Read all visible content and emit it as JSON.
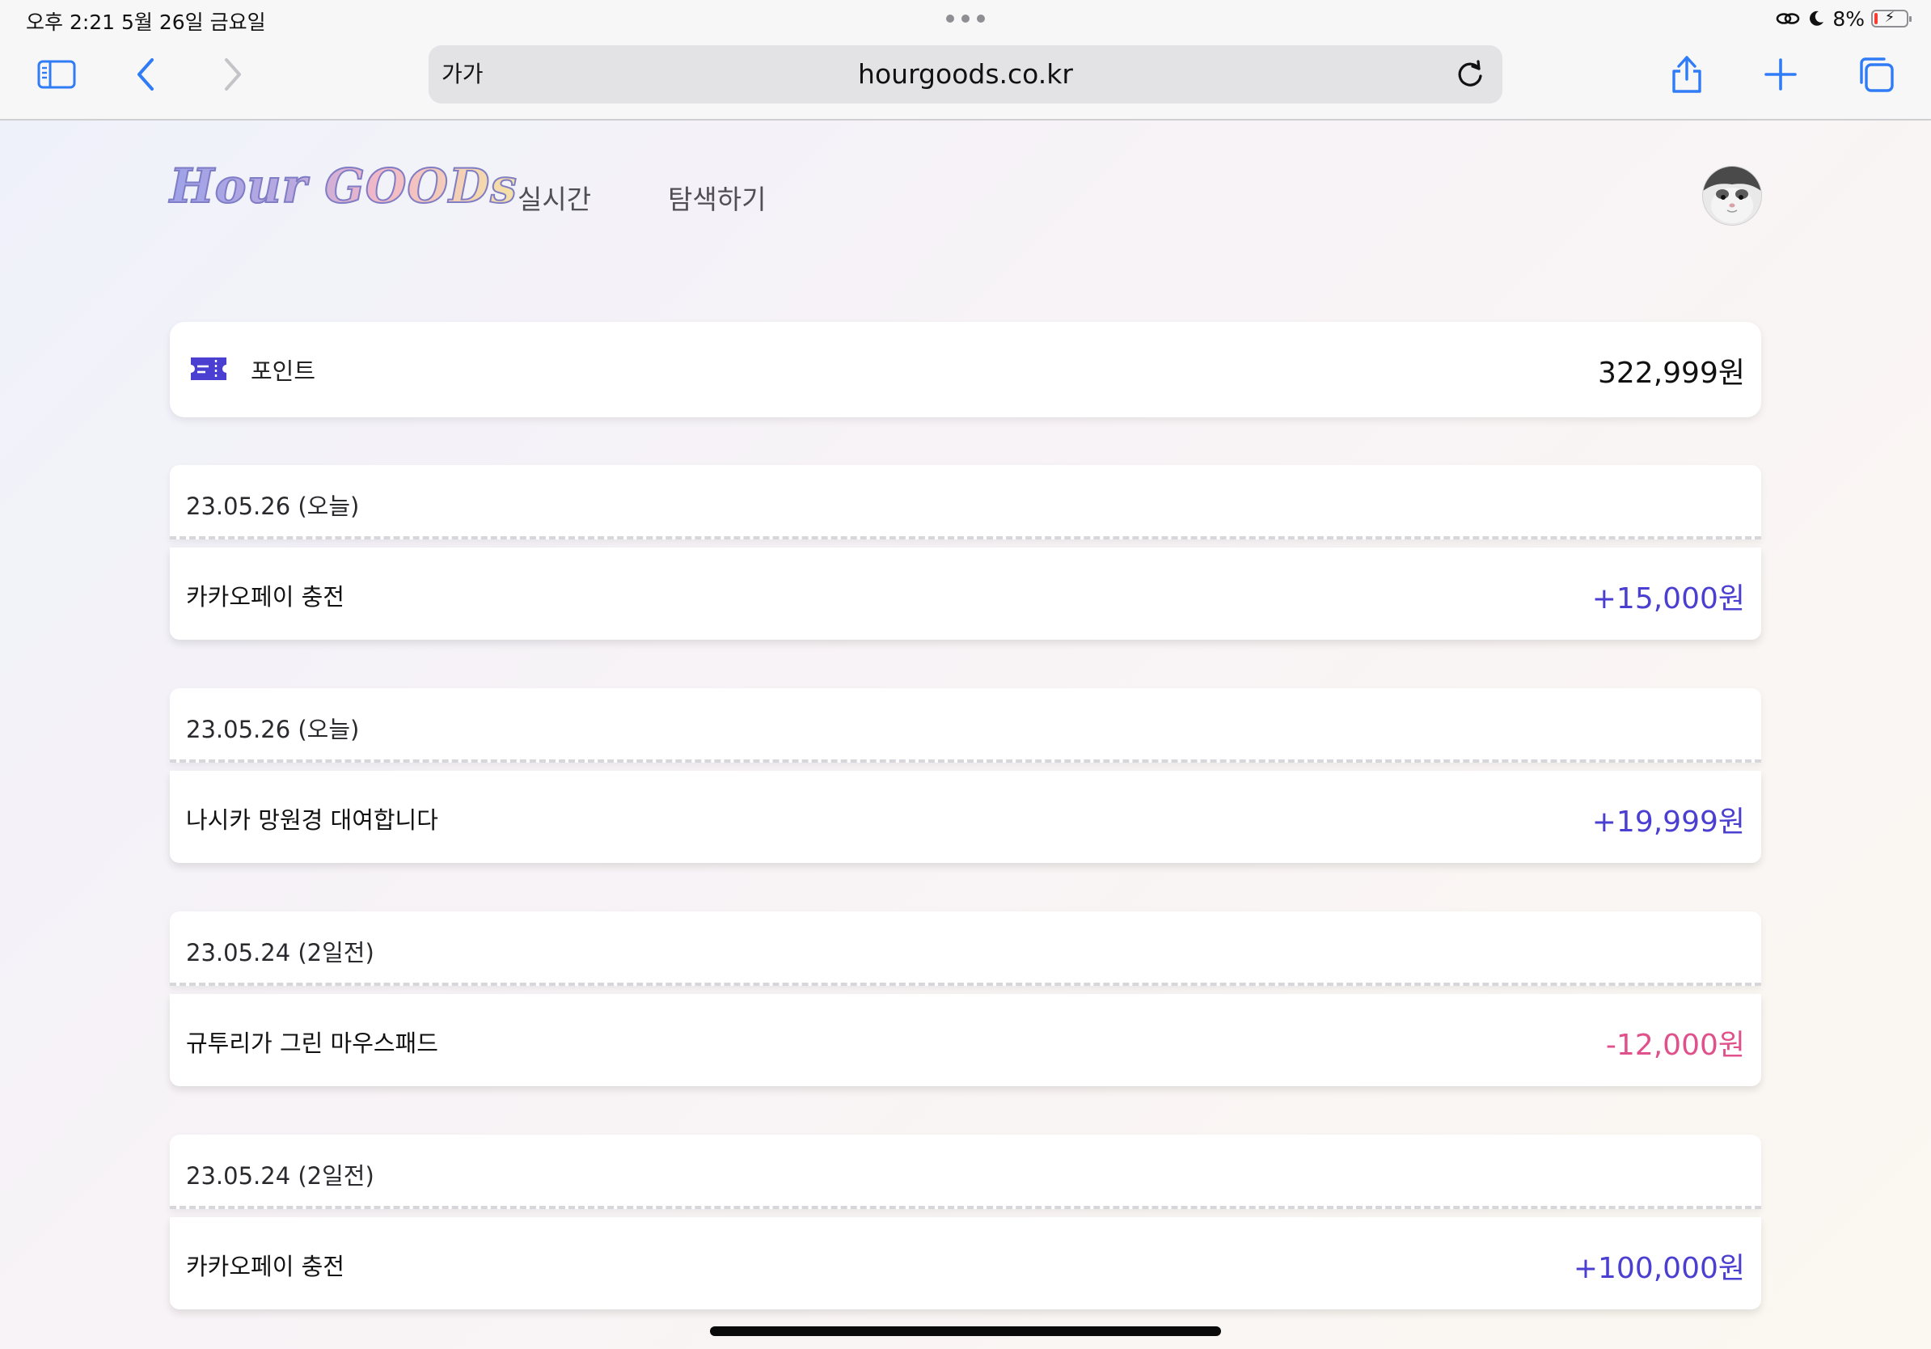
{
  "status_bar": {
    "time": "오후 2:21",
    "date": "5월 26일 금요일",
    "battery_percent": "8%",
    "battery_level": 0.08,
    "icons": [
      "link-icon",
      "moon-icon",
      "battery-charging-icon"
    ]
  },
  "browser": {
    "reader_label": "가가",
    "url": "hourgoods.co.kr",
    "buttons": [
      "sidebar-icon",
      "back-icon",
      "forward-icon",
      "reload-icon",
      "share-icon",
      "new-tab-icon",
      "tabs-icon"
    ]
  },
  "site": {
    "logo": "Hour GOODs",
    "nav": [
      {
        "label": "실시간"
      },
      {
        "label": "탐색하기"
      }
    ]
  },
  "points": {
    "label": "포인트",
    "value": "322,999원",
    "icon": "ticket-icon"
  },
  "transactions": [
    {
      "date": "23.05.26 (오늘)",
      "title": "카카오페이 충전",
      "amount": "+15,000원",
      "type": "plus"
    },
    {
      "date": "23.05.26 (오늘)",
      "title": "나시카 망원경 대여합니다",
      "amount": "+19,999원",
      "type": "plus"
    },
    {
      "date": "23.05.24 (2일전)",
      "title": "규투리가 그린 마우스패드",
      "amount": "-12,000원",
      "type": "minus"
    },
    {
      "date": "23.05.24 (2일전)",
      "title": "카카오페이 충전",
      "amount": "+100,000원",
      "type": "plus"
    }
  ],
  "colors": {
    "accent": "#4b3fd1",
    "positive": "#4b3fd1",
    "negative": "#e0508b",
    "safari_blue": "#2f7cf6"
  }
}
